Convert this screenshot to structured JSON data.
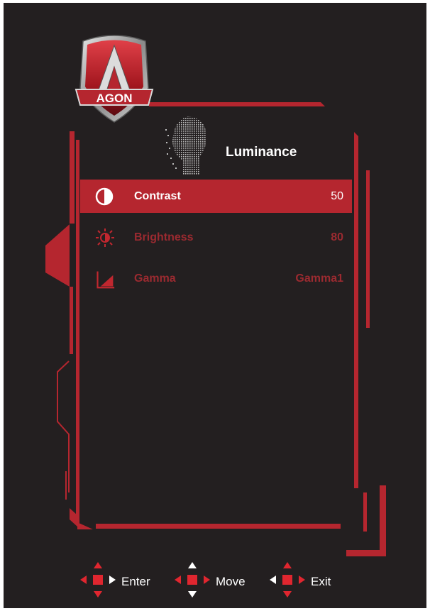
{
  "brand": {
    "logo_text": "AGON"
  },
  "menu": {
    "title": "Luminance",
    "items": [
      {
        "label": "Contrast",
        "value": "50",
        "icon": "contrast-icon",
        "state": "selected"
      },
      {
        "label": "Brightness",
        "value": "80",
        "icon": "brightness-icon",
        "state": "dim"
      },
      {
        "label": "Gamma",
        "value": "Gamma1",
        "icon": "gamma-icon",
        "state": "dim"
      }
    ]
  },
  "hints": [
    {
      "label": "Enter",
      "icon": "dpad-enter-icon"
    },
    {
      "label": "Move",
      "icon": "dpad-move-icon"
    },
    {
      "label": "Exit",
      "icon": "dpad-exit-icon"
    }
  ],
  "colors": {
    "background": "#231f20",
    "accent": "#b5262f",
    "text": "#ffffff"
  }
}
